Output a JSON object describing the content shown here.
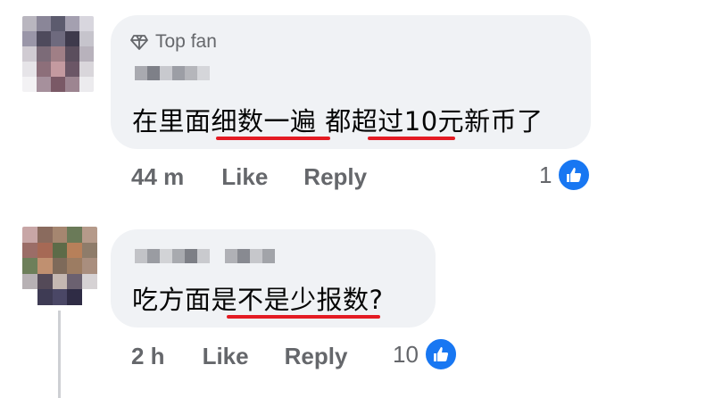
{
  "comments": [
    {
      "badge": "Top fan",
      "text_parts": [
        "在里面",
        "细数一遍",
        " 都",
        "超过10",
        "元新币了"
      ],
      "time": "44 m",
      "like_label": "Like",
      "reply_label": "Reply",
      "reaction_count": "1"
    },
    {
      "text_parts": [
        "吃方面是",
        "不是少报数",
        "?"
      ],
      "time": "2 h",
      "like_label": "Like",
      "reply_label": "Reply",
      "reaction_count": "10"
    }
  ],
  "colors": {
    "bubble": "#f0f2f5",
    "underline": "#e41b23",
    "like_blue": "#1877f2",
    "secondary_text": "#65676b"
  },
  "icons": {
    "badge": "diamond-icon",
    "reaction": "thumbs-up-icon"
  }
}
